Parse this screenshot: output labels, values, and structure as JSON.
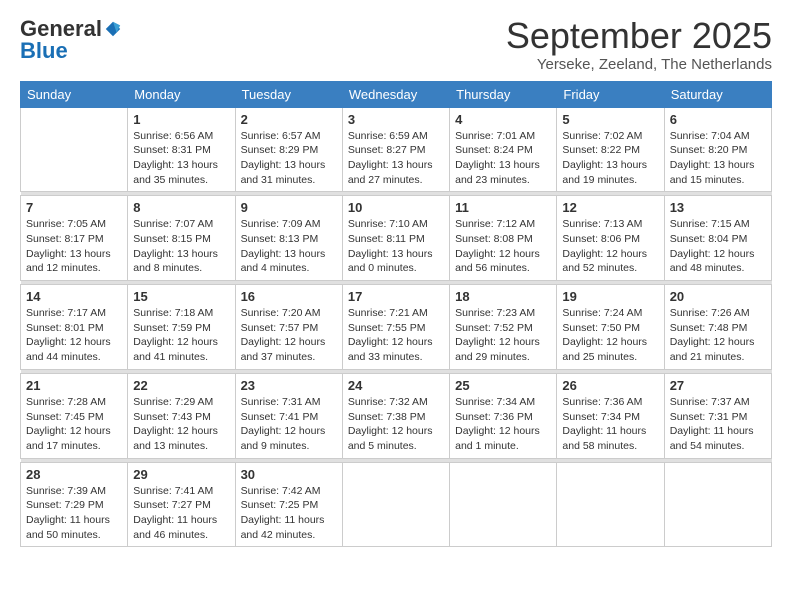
{
  "logo": {
    "general": "General",
    "blue": "Blue"
  },
  "header": {
    "month": "September 2025",
    "location": "Yerseke, Zeeland, The Netherlands"
  },
  "weekdays": [
    "Sunday",
    "Monday",
    "Tuesday",
    "Wednesday",
    "Thursday",
    "Friday",
    "Saturday"
  ],
  "weeks": [
    [
      {
        "day": "",
        "sunrise": "",
        "sunset": "",
        "daylight": ""
      },
      {
        "day": "1",
        "sunrise": "Sunrise: 6:56 AM",
        "sunset": "Sunset: 8:31 PM",
        "daylight": "Daylight: 13 hours and 35 minutes."
      },
      {
        "day": "2",
        "sunrise": "Sunrise: 6:57 AM",
        "sunset": "Sunset: 8:29 PM",
        "daylight": "Daylight: 13 hours and 31 minutes."
      },
      {
        "day": "3",
        "sunrise": "Sunrise: 6:59 AM",
        "sunset": "Sunset: 8:27 PM",
        "daylight": "Daylight: 13 hours and 27 minutes."
      },
      {
        "day": "4",
        "sunrise": "Sunrise: 7:01 AM",
        "sunset": "Sunset: 8:24 PM",
        "daylight": "Daylight: 13 hours and 23 minutes."
      },
      {
        "day": "5",
        "sunrise": "Sunrise: 7:02 AM",
        "sunset": "Sunset: 8:22 PM",
        "daylight": "Daylight: 13 hours and 19 minutes."
      },
      {
        "day": "6",
        "sunrise": "Sunrise: 7:04 AM",
        "sunset": "Sunset: 8:20 PM",
        "daylight": "Daylight: 13 hours and 15 minutes."
      }
    ],
    [
      {
        "day": "7",
        "sunrise": "Sunrise: 7:05 AM",
        "sunset": "Sunset: 8:17 PM",
        "daylight": "Daylight: 13 hours and 12 minutes."
      },
      {
        "day": "8",
        "sunrise": "Sunrise: 7:07 AM",
        "sunset": "Sunset: 8:15 PM",
        "daylight": "Daylight: 13 hours and 8 minutes."
      },
      {
        "day": "9",
        "sunrise": "Sunrise: 7:09 AM",
        "sunset": "Sunset: 8:13 PM",
        "daylight": "Daylight: 13 hours and 4 minutes."
      },
      {
        "day": "10",
        "sunrise": "Sunrise: 7:10 AM",
        "sunset": "Sunset: 8:11 PM",
        "daylight": "Daylight: 13 hours and 0 minutes."
      },
      {
        "day": "11",
        "sunrise": "Sunrise: 7:12 AM",
        "sunset": "Sunset: 8:08 PM",
        "daylight": "Daylight: 12 hours and 56 minutes."
      },
      {
        "day": "12",
        "sunrise": "Sunrise: 7:13 AM",
        "sunset": "Sunset: 8:06 PM",
        "daylight": "Daylight: 12 hours and 52 minutes."
      },
      {
        "day": "13",
        "sunrise": "Sunrise: 7:15 AM",
        "sunset": "Sunset: 8:04 PM",
        "daylight": "Daylight: 12 hours and 48 minutes."
      }
    ],
    [
      {
        "day": "14",
        "sunrise": "Sunrise: 7:17 AM",
        "sunset": "Sunset: 8:01 PM",
        "daylight": "Daylight: 12 hours and 44 minutes."
      },
      {
        "day": "15",
        "sunrise": "Sunrise: 7:18 AM",
        "sunset": "Sunset: 7:59 PM",
        "daylight": "Daylight: 12 hours and 41 minutes."
      },
      {
        "day": "16",
        "sunrise": "Sunrise: 7:20 AM",
        "sunset": "Sunset: 7:57 PM",
        "daylight": "Daylight: 12 hours and 37 minutes."
      },
      {
        "day": "17",
        "sunrise": "Sunrise: 7:21 AM",
        "sunset": "Sunset: 7:55 PM",
        "daylight": "Daylight: 12 hours and 33 minutes."
      },
      {
        "day": "18",
        "sunrise": "Sunrise: 7:23 AM",
        "sunset": "Sunset: 7:52 PM",
        "daylight": "Daylight: 12 hours and 29 minutes."
      },
      {
        "day": "19",
        "sunrise": "Sunrise: 7:24 AM",
        "sunset": "Sunset: 7:50 PM",
        "daylight": "Daylight: 12 hours and 25 minutes."
      },
      {
        "day": "20",
        "sunrise": "Sunrise: 7:26 AM",
        "sunset": "Sunset: 7:48 PM",
        "daylight": "Daylight: 12 hours and 21 minutes."
      }
    ],
    [
      {
        "day": "21",
        "sunrise": "Sunrise: 7:28 AM",
        "sunset": "Sunset: 7:45 PM",
        "daylight": "Daylight: 12 hours and 17 minutes."
      },
      {
        "day": "22",
        "sunrise": "Sunrise: 7:29 AM",
        "sunset": "Sunset: 7:43 PM",
        "daylight": "Daylight: 12 hours and 13 minutes."
      },
      {
        "day": "23",
        "sunrise": "Sunrise: 7:31 AM",
        "sunset": "Sunset: 7:41 PM",
        "daylight": "Daylight: 12 hours and 9 minutes."
      },
      {
        "day": "24",
        "sunrise": "Sunrise: 7:32 AM",
        "sunset": "Sunset: 7:38 PM",
        "daylight": "Daylight: 12 hours and 5 minutes."
      },
      {
        "day": "25",
        "sunrise": "Sunrise: 7:34 AM",
        "sunset": "Sunset: 7:36 PM",
        "daylight": "Daylight: 12 hours and 1 minute."
      },
      {
        "day": "26",
        "sunrise": "Sunrise: 7:36 AM",
        "sunset": "Sunset: 7:34 PM",
        "daylight": "Daylight: 11 hours and 58 minutes."
      },
      {
        "day": "27",
        "sunrise": "Sunrise: 7:37 AM",
        "sunset": "Sunset: 7:31 PM",
        "daylight": "Daylight: 11 hours and 54 minutes."
      }
    ],
    [
      {
        "day": "28",
        "sunrise": "Sunrise: 7:39 AM",
        "sunset": "Sunset: 7:29 PM",
        "daylight": "Daylight: 11 hours and 50 minutes."
      },
      {
        "day": "29",
        "sunrise": "Sunrise: 7:41 AM",
        "sunset": "Sunset: 7:27 PM",
        "daylight": "Daylight: 11 hours and 46 minutes."
      },
      {
        "day": "30",
        "sunrise": "Sunrise: 7:42 AM",
        "sunset": "Sunset: 7:25 PM",
        "daylight": "Daylight: 11 hours and 42 minutes."
      },
      {
        "day": "",
        "sunrise": "",
        "sunset": "",
        "daylight": ""
      },
      {
        "day": "",
        "sunrise": "",
        "sunset": "",
        "daylight": ""
      },
      {
        "day": "",
        "sunrise": "",
        "sunset": "",
        "daylight": ""
      },
      {
        "day": "",
        "sunrise": "",
        "sunset": "",
        "daylight": ""
      }
    ]
  ]
}
